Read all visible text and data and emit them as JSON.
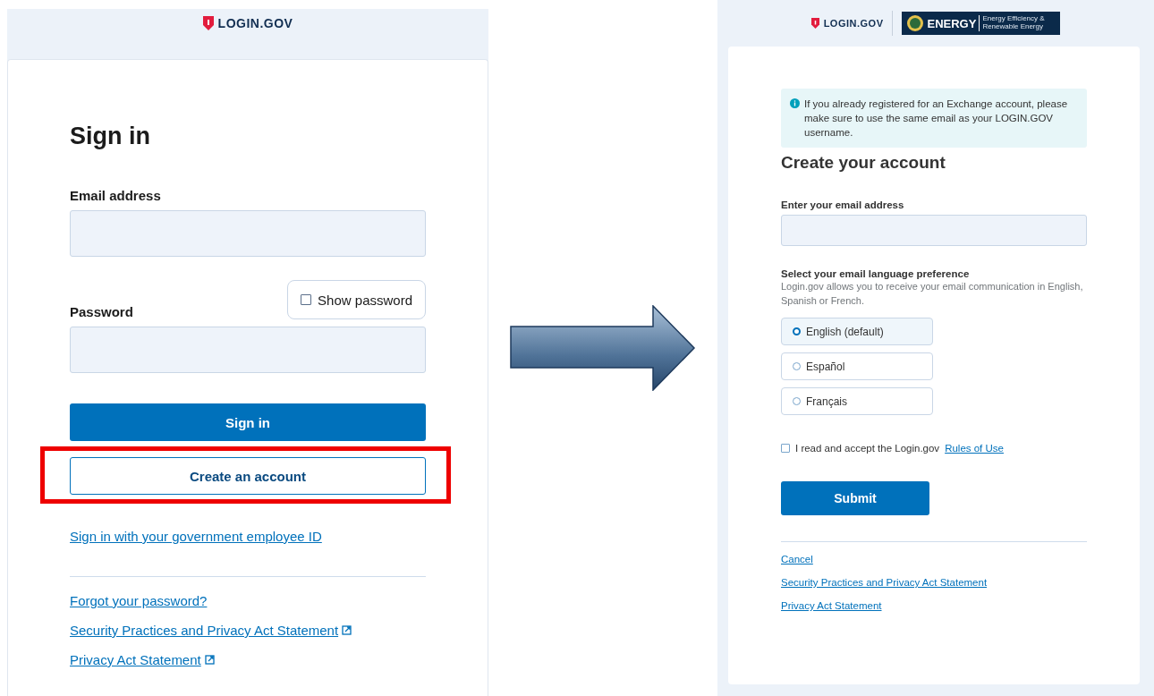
{
  "sign_in_page": {
    "logo": "LOGIN.GOV",
    "title": "Sign in",
    "email": {
      "label": "Email address"
    },
    "show_password": {
      "label": "Show password",
      "checked": false
    },
    "password": {
      "label": "Password"
    },
    "sign_in_button": "Sign in",
    "create_account_button": {
      "label": "Create an account",
      "highlighted": true
    },
    "piv_link": "Sign in with your government employee ID",
    "links": [
      {
        "label": "Forgot your password?",
        "external": false
      },
      {
        "label": "Security Practices and Privacy Act Statement",
        "external": true
      },
      {
        "label": "Privacy Act Statement",
        "external": true
      }
    ]
  },
  "create_account_page": {
    "logo": "LOGIN.GOV",
    "partner_logo": {
      "name": "ENERGY",
      "subtitle": "Energy Efficiency & Renewable Energy"
    },
    "alert": "If you already registered for an Exchange account, please make sure to use the same email as your LOGIN.GOV username.",
    "title": "Create your account",
    "email": {
      "label": "Enter your email address"
    },
    "language": {
      "label": "Select your email language preference",
      "hint": "Login.gov allows you to receive your email communication in English, Spanish or French.",
      "options": [
        {
          "label": "English (default)",
          "selected": true
        },
        {
          "label": "Español",
          "selected": false
        },
        {
          "label": "Français",
          "selected": false
        }
      ]
    },
    "terms": {
      "text": "I read and accept the Login.gov",
      "link": "Rules of Use",
      "checked": false
    },
    "submit_button": "Submit",
    "links": [
      "Cancel",
      "Security Practices and Privacy Act Statement",
      "Privacy Act Statement"
    ]
  }
}
